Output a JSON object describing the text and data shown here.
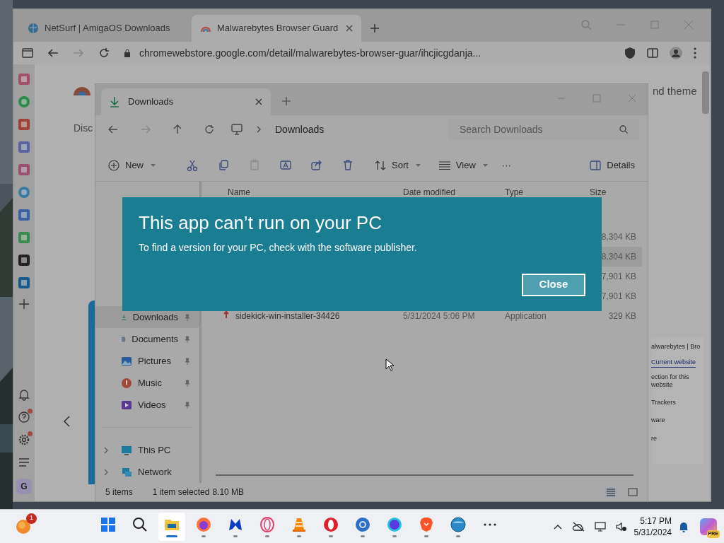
{
  "browser": {
    "tabs": [
      {
        "title": "NetSurf | AmigaOS Downloads",
        "selected": false
      },
      {
        "title": "Malwarebytes Browser Guard",
        "selected": true
      }
    ],
    "url": "chromewebstore.google.com/detail/malwarebytes-browser-guar/ihcjicgdanja...",
    "dock": [
      {
        "kind": "slack"
      },
      {
        "kind": "whatsapp"
      },
      {
        "kind": "gmail"
      },
      {
        "kind": "discord"
      },
      {
        "kind": "instagram"
      },
      {
        "kind": "telegram"
      },
      {
        "kind": "calendar"
      },
      {
        "kind": "drive"
      },
      {
        "kind": "notion"
      },
      {
        "kind": "linkedin"
      },
      {
        "kind": "add"
      }
    ],
    "dock_bottom": [
      {
        "kind": "bell",
        "badge": false
      },
      {
        "kind": "help",
        "badge": true
      },
      {
        "kind": "settings",
        "badge": true
      },
      {
        "kind": "menu",
        "badge": false
      },
      {
        "kind": "avatar",
        "letter": "G"
      }
    ],
    "page_fragments": {
      "left": "Disc",
      "right": "nd theme"
    },
    "side_panel": {
      "title": "alwarebytes | Bro",
      "tab": "Current website",
      "heading": "ection for this website",
      "rows": [
        "Trackers",
        "ware",
        "re"
      ]
    }
  },
  "explorer": {
    "tab": "Downloads",
    "breadcrumb": "Downloads",
    "search": {
      "placeholder": "Search Downloads"
    },
    "toolbar": [
      {
        "kind": "new",
        "label": "New",
        "disabled": false
      },
      {
        "kind": "cut",
        "disabled": false
      },
      {
        "kind": "copy",
        "disabled": false
      },
      {
        "kind": "paste",
        "disabled": true
      },
      {
        "kind": "rename",
        "disabled": false
      },
      {
        "kind": "share",
        "disabled": false
      },
      {
        "kind": "delete",
        "disabled": false
      },
      {
        "kind": "sort",
        "label": "Sort",
        "disabled": false
      },
      {
        "kind": "view",
        "label": "View",
        "disabled": false
      },
      {
        "kind": "more",
        "label": "···",
        "disabled": false
      },
      {
        "kind": "details",
        "label": "Details",
        "disabled": false
      }
    ],
    "columns": [
      "Name",
      "Date modified",
      "Type",
      "Size"
    ],
    "rows": [
      {
        "size": "8,304 KB",
        "selected": false
      },
      {
        "size": "8,304 KB",
        "selected": true
      },
      {
        "size": "7,901 KB",
        "selected": false
      },
      {
        "size": "7,901 KB",
        "selected": false
      },
      {
        "name": "sidekick-win-installer-34426",
        "date": "5/31/2024 5:06 PM",
        "type": "Application",
        "size": "329 KB",
        "selected": false
      }
    ],
    "nav": [
      {
        "label": "Downloads",
        "kind": "downloads",
        "pinned": true,
        "selected": true
      },
      {
        "label": "Documents",
        "kind": "documents",
        "pinned": true,
        "selected": false
      },
      {
        "label": "Pictures",
        "kind": "pictures",
        "pinned": true,
        "selected": false
      },
      {
        "label": "Music",
        "kind": "music",
        "pinned": true,
        "selected": false
      },
      {
        "label": "Videos",
        "kind": "videos",
        "pinned": true,
        "selected": false
      },
      {
        "label": "This PC",
        "kind": "pc",
        "pinned": false,
        "selected": false
      },
      {
        "label": "Network",
        "kind": "network",
        "pinned": false,
        "selected": false
      }
    ],
    "status": {
      "count": "5 items",
      "selection": "1 item selected",
      "size": "8.10 MB"
    }
  },
  "dialog": {
    "title": "This app can’t run on your PC",
    "message": "To find a version for your PC, check with the software publisher.",
    "button": "Close"
  },
  "taskbar": {
    "notification_badge": "1",
    "apps": [
      {
        "kind": "start",
        "running": false,
        "active": false
      },
      {
        "kind": "search",
        "running": false,
        "active": false
      },
      {
        "kind": "explorer",
        "running": true,
        "active": true
      },
      {
        "kind": "firefox",
        "running": true,
        "active": false
      },
      {
        "kind": "malwarebytes",
        "running": true,
        "active": false
      },
      {
        "kind": "operagx",
        "running": true,
        "active": false
      },
      {
        "kind": "vlc",
        "running": true,
        "active": false
      },
      {
        "kind": "opera",
        "running": true,
        "active": false
      },
      {
        "kind": "chromium",
        "running": true,
        "active": false
      },
      {
        "kind": "orb",
        "running": true,
        "active": false
      },
      {
        "kind": "brave",
        "running": true,
        "active": false
      },
      {
        "kind": "globe",
        "running": true,
        "active": false
      },
      {
        "kind": "more",
        "running": false,
        "active": false
      }
    ],
    "time": "5:17 PM",
    "date": "5/31/2024",
    "copilot_label": "PRE"
  }
}
